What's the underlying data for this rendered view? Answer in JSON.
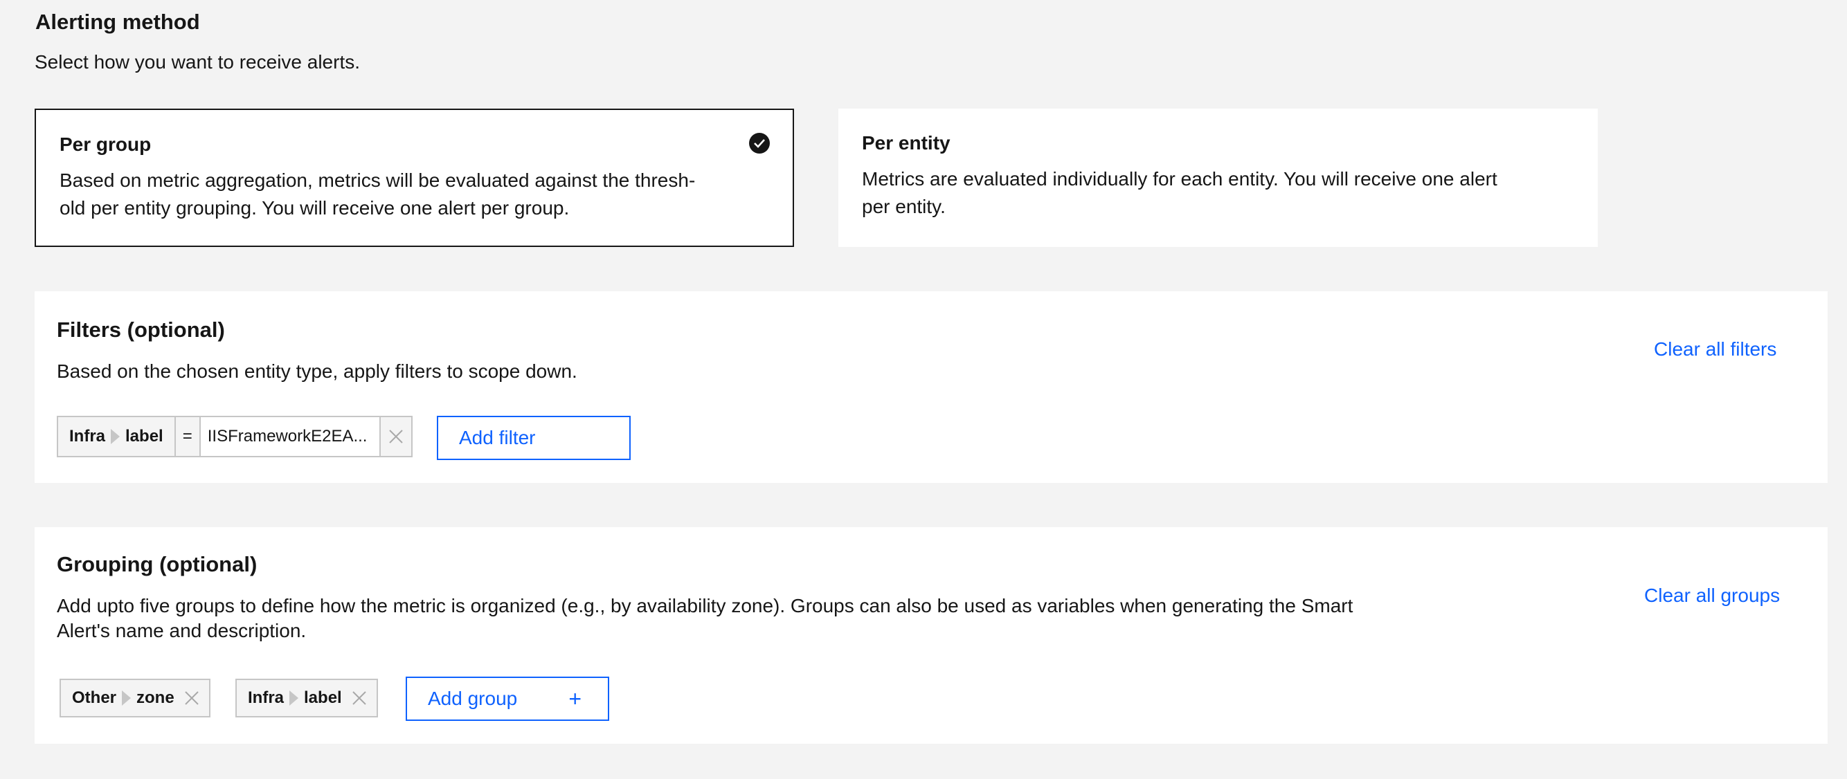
{
  "alerting": {
    "title": "Alerting method",
    "description": "Select how you want to receive alerts.",
    "options": [
      {
        "title": "Per group",
        "description_line1": "Based on metric aggregation, metrics will be evaluated against the thresh-",
        "description_line2": "old per entity grouping. You will receive one alert per group.",
        "selected": true
      },
      {
        "title": "Per entity",
        "description_line1": "Metrics are evaluated individually for each entity. You will receive one alert",
        "description_line2": "per entity.",
        "selected": false
      }
    ]
  },
  "filters": {
    "title": "Filters (optional)",
    "description": "Based on the chosen entity type, apply filters to scope down.",
    "clear_label": "Clear all filters",
    "items": [
      {
        "category": "Infra",
        "key": "label",
        "operator": "=",
        "value": "IISFrameworkE2EA..."
      }
    ],
    "add_label": "Add filter"
  },
  "grouping": {
    "title": "Grouping (optional)",
    "description_line1": "Add upto five groups to define how the metric is organized (e.g., by availability zone). Groups can also be used as variables when generating the Smart",
    "description_line2": "Alert's name and description.",
    "clear_label": "Clear all groups",
    "items": [
      {
        "category": "Other",
        "key": "zone"
      },
      {
        "category": "Infra",
        "key": "label"
      }
    ],
    "add_label": "Add group",
    "add_icon": "+"
  },
  "colors": {
    "accent": "#0f62fe",
    "text": "#161616",
    "background": "#f3f3f3"
  }
}
